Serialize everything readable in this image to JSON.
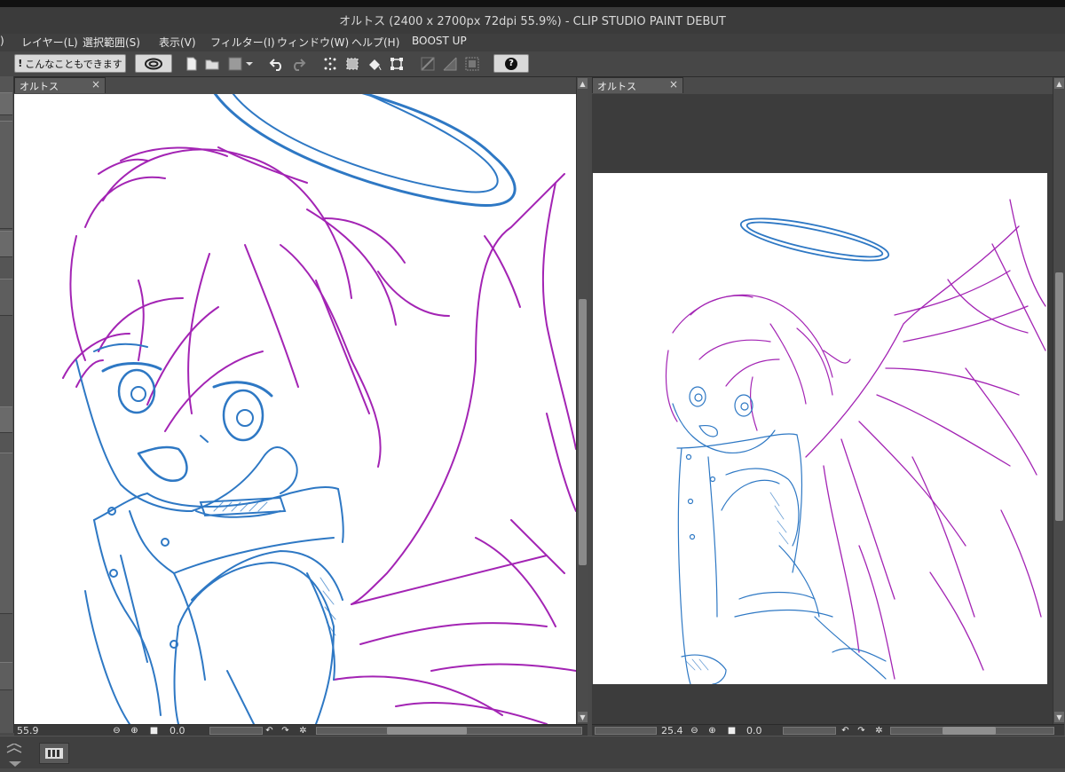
{
  "window": {
    "title": "オルトス (2400 x 2700px 72dpi 55.9%)  - CLIP STUDIO PAINT DEBUT"
  },
  "menu": [
    {
      "id": "partial",
      "label": ")"
    },
    {
      "id": "layer",
      "label": "レイヤー(L)"
    },
    {
      "id": "selection",
      "label": "選択範囲(S)"
    },
    {
      "id": "view",
      "label": "表示(V)"
    },
    {
      "id": "filter",
      "label": "フィルター(I)"
    },
    {
      "id": "window",
      "label": "ウィンドウ(W)"
    },
    {
      "id": "help",
      "label": "ヘルプ(H)"
    },
    {
      "id": "boost",
      "label": "BOOST UP"
    }
  ],
  "toolbar": {
    "tips_label": "こんなこともできます",
    "help_label": "?"
  },
  "canvas_left": {
    "tab_label": "オルトス",
    "zoom": "55.9",
    "rotation": "0.0"
  },
  "canvas_right": {
    "tab_label": "オルトス",
    "zoom": "25.4",
    "rotation": "0.0"
  },
  "colors": {
    "lineart_blue": "#2e78c4",
    "lineart_magenta": "#a324b4",
    "panel_bg": "#3c3c3c"
  }
}
